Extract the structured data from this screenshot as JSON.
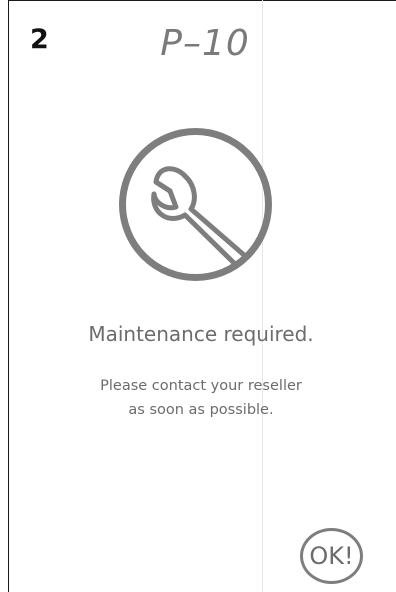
{
  "header": {
    "step_number": "2",
    "screen_code": "P–10"
  },
  "icon": {
    "name": "wrench-icon",
    "color": "#7e7e7e"
  },
  "message": {
    "title": "Maintenance required.",
    "line1": "Please contact your reseller",
    "line2": "as soon as possible."
  },
  "actions": {
    "ok_label": "OK!"
  },
  "colors": {
    "text": "#6c6c6c",
    "border": "#1a1a1a",
    "icon_stroke": "#7e7e7e"
  }
}
